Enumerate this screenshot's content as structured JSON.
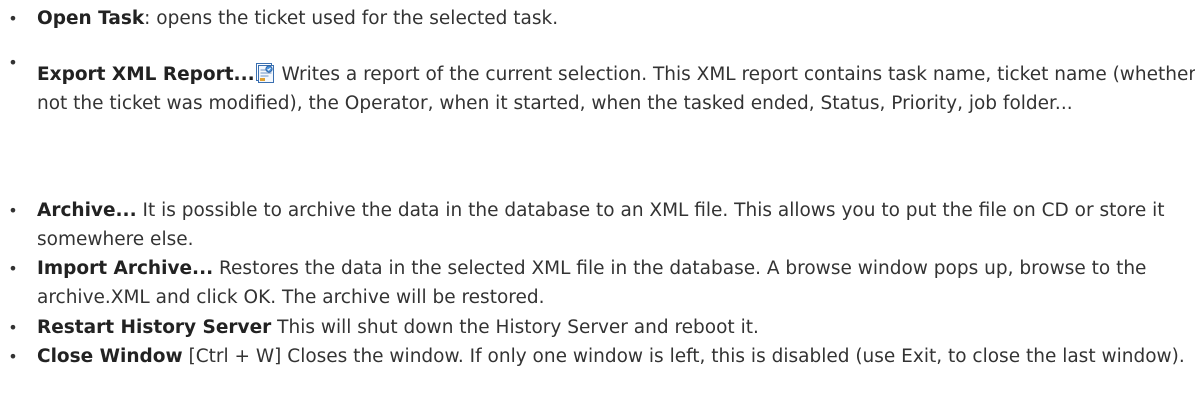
{
  "items": [
    {
      "term": "Open Task",
      "separator": ":",
      "description": " opens the ticket used for the selected task."
    },
    {
      "term": "Export XML Report...",
      "icon": "xml-report-icon",
      "description": " Writes a report of the current selection. This XML report contains task name, ticket name (whether or not the ticket was modified), the Operator, when it started, when the tasked ended, Status, Priority, job folder..."
    },
    {
      "term": "Archive...",
      "description": " It is possible to archive the data in the database to an XML file. This allows you to put the file on CD or store it somewhere else."
    },
    {
      "term": "Import Archive...",
      "description": " Restores the data in the selected XML file in the database. A browse window pops up, browse to the archive.XML and click OK. The archive will be restored."
    },
    {
      "term": "Restart History Server",
      "description": " This will shut down the History Server and reboot it."
    },
    {
      "term": "Close Window",
      "shortcut": " [Ctrl + W]",
      "description": " Closes the window. If only one window is left, this is disabled (use Exit, to close the last window)."
    }
  ],
  "bullet_char": "•"
}
